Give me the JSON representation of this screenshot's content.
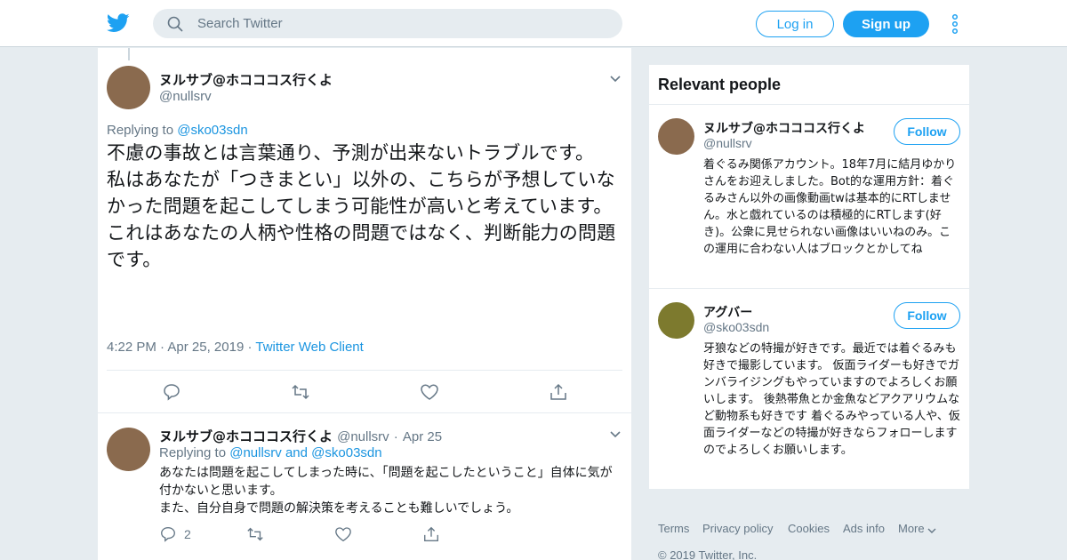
{
  "nav": {
    "search_placeholder": "Search Twitter",
    "login_label": "Log in",
    "signup_label": "Sign up",
    "icons": [
      "twitter-bird-icon",
      "search-icon",
      "more-vertical-icon"
    ]
  },
  "colors": {
    "brand": "#1da1f2",
    "link": "#1b95e0",
    "secondary_text": "#657786",
    "background": "#e6ecf0",
    "avatar_nullsrv": "#8a6a4e",
    "avatar_sko03sdn": "#7d7a2e"
  },
  "main_tweet": {
    "name": "ヌルサブ@ホコココス行くよ",
    "handle": "@nullsrv",
    "replying_prefix": "Replying to",
    "replying_to": "@sko03sdn",
    "text_lines": [
      "不慮の事故とは言葉通り、予測が出来ないトラブルです。",
      "私はあなたが「つきまとい」以外の、こちらが予想していなかった問題を起こしてしまう可能性が高いと考えています。",
      "これはあなたの人柄や性格の問題ではなく、判断能力の問題です。"
    ],
    "time": "4:22 PM",
    "date": "Apr 25, 2019",
    "dot": "·",
    "client": "Twitter Web Client"
  },
  "reply_tweet": {
    "name": "ヌルサブ@ホコココス行くよ",
    "handle": "@nullsrv",
    "dot": "·",
    "date": "Apr 25",
    "replying_prefix": "Replying to",
    "replying_a": "@nullsrv",
    "and": "and",
    "replying_b": "@sko03sdn",
    "text_lines": [
      "あなたは問題を起こしてしまった時に、「問題を起こしたということ」自体に気が付かないと思います。",
      "また、自分自身で問題の解決策を考えることも難しいでしょう。"
    ],
    "reply_count": "2"
  },
  "sidebar": {
    "title": "Relevant people",
    "people": [
      {
        "name": "ヌルサブ@ホコココス行くよ",
        "handle": "@nullsrv",
        "follow_label": "Follow",
        "bio": "着ぐるみ関係アカウント。18年7月に結月ゆかりさんをお迎えしました。Bot的な運用方針：着ぐるみさん以外の画像動画twは基本的にRTしません。水と戯れているのは積極的にRTします(好き)。公衆に見せられない画像はいいねのみ。この運用に合わない人はブロックとかしてね"
      },
      {
        "name": "アグバー",
        "handle": "@sko03sdn",
        "follow_label": "Follow",
        "bio": "牙狼などの特撮が好きです。最近では着ぐるみも好きで撮影しています。 仮面ライダーも好きでガンバライジングもやっていますのでよろしくお願いします。 後熱帯魚とか金魚などアクアリウムなど動物系も好きです 着ぐるみやっている人や、仮面ライダーなどの特撮が好きならフォローしますのでよろしくお願いします。"
      }
    ]
  },
  "footer": {
    "terms": "Terms",
    "privacy": "Privacy policy",
    "cookies": "Cookies",
    "ads": "Ads info",
    "more": "More",
    "copyright": "© 2019 Twitter, Inc."
  }
}
